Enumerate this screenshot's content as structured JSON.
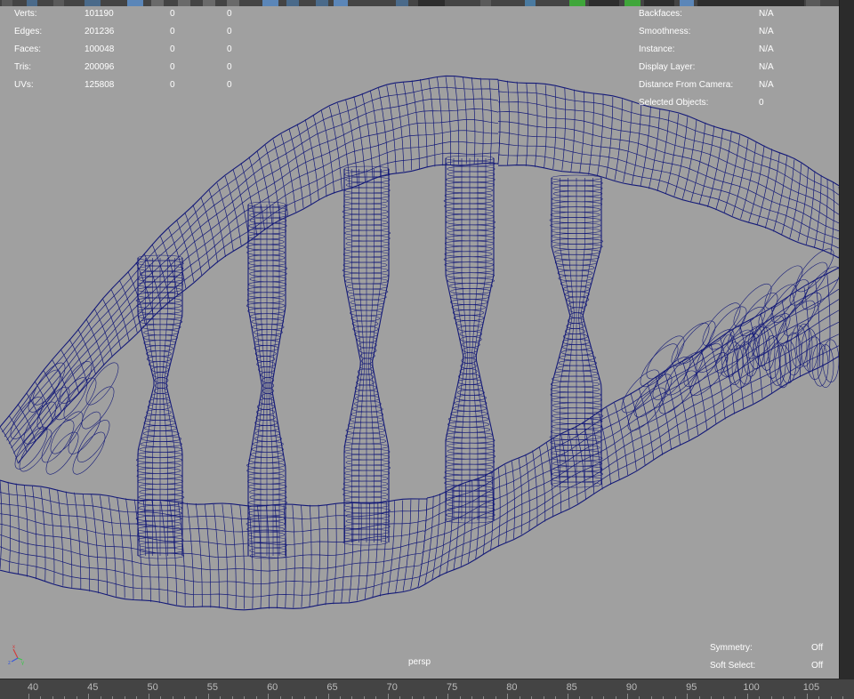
{
  "hud_stats": {
    "rows": [
      {
        "label": "Verts:",
        "value": "101190",
        "selected": "0",
        "component": "0"
      },
      {
        "label": "Edges:",
        "value": "201236",
        "selected": "0",
        "component": "0"
      },
      {
        "label": "Faces:",
        "value": "100048",
        "selected": "0",
        "component": "0"
      },
      {
        "label": "Tris:",
        "value": "200096",
        "selected": "0",
        "component": "0"
      },
      {
        "label": "UVs:",
        "value": "125808",
        "selected": "0",
        "component": "0"
      }
    ]
  },
  "hud_object": {
    "rows": [
      {
        "label": "Backfaces:",
        "value": "N/A"
      },
      {
        "label": "Smoothness:",
        "value": "N/A"
      },
      {
        "label": "Instance:",
        "value": "N/A"
      },
      {
        "label": "Display Layer:",
        "value": "N/A"
      },
      {
        "label": "Distance From Camera:",
        "value": "N/A"
      },
      {
        "label": "Selected Objects:",
        "value": "0"
      }
    ]
  },
  "hud_bottom": {
    "symmetry_label": "Symmetry:",
    "symmetry_value": "Off",
    "soft_select_label": "Soft Select:",
    "soft_select_value": "Off"
  },
  "camera_name": "persp",
  "timeline": {
    "ticks": [
      "40",
      "45",
      "50",
      "55",
      "60",
      "65",
      "70",
      "75",
      "80",
      "85",
      "90",
      "95",
      "100",
      "105"
    ]
  },
  "colors": {
    "viewport_bg": "#a0a0a0",
    "wireframe": "#141a78",
    "hud_text": "#ffffff"
  },
  "icons": [
    "axis-gizmo-icon"
  ]
}
